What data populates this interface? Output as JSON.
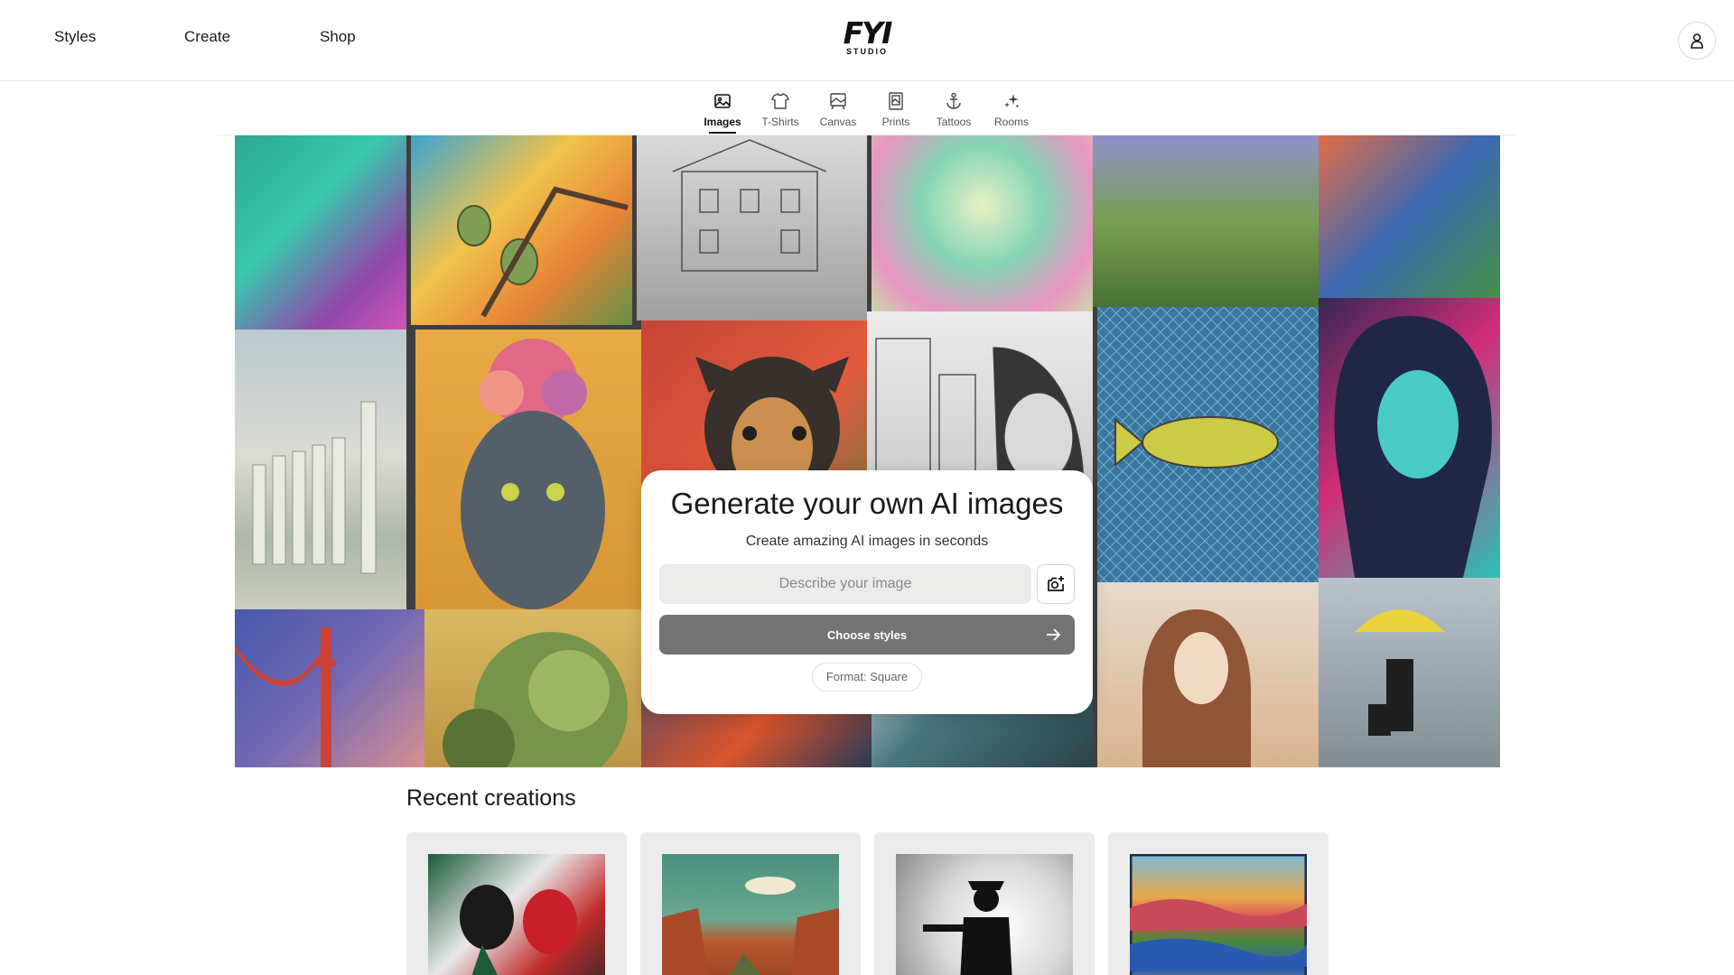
{
  "header": {
    "nav": [
      {
        "label": "Styles"
      },
      {
        "label": "Create"
      },
      {
        "label": "Shop"
      }
    ],
    "logo_text": "FYI",
    "logo_subtext": "STUDIO",
    "account_icon": "user-icon"
  },
  "tabs": [
    {
      "label": "Images",
      "icon": "image-icon",
      "active": true
    },
    {
      "label": "T-Shirts",
      "icon": "tshirt-icon",
      "active": false
    },
    {
      "label": "Canvas",
      "icon": "canvas-icon",
      "active": false
    },
    {
      "label": "Prints",
      "icon": "print-icon",
      "active": false
    },
    {
      "label": "Tattoos",
      "icon": "anchor-icon",
      "active": false
    },
    {
      "label": "Rooms",
      "icon": "sparkle-icon",
      "active": false
    }
  ],
  "hero": {
    "title": "Generate your own AI images",
    "subtitle": "Create amazing AI images in seconds",
    "input_placeholder": "Describe your image",
    "input_value": "",
    "upload_icon": "camera-add-icon",
    "choose_label": "Choose styles",
    "choose_icon": "arrow-right-icon",
    "format_label": "Format: Square"
  },
  "recent": {
    "title": "Recent creations"
  },
  "colors": {
    "primary_button": "#737373",
    "input_bg": "#ececea",
    "card_bg": "#ececec"
  }
}
